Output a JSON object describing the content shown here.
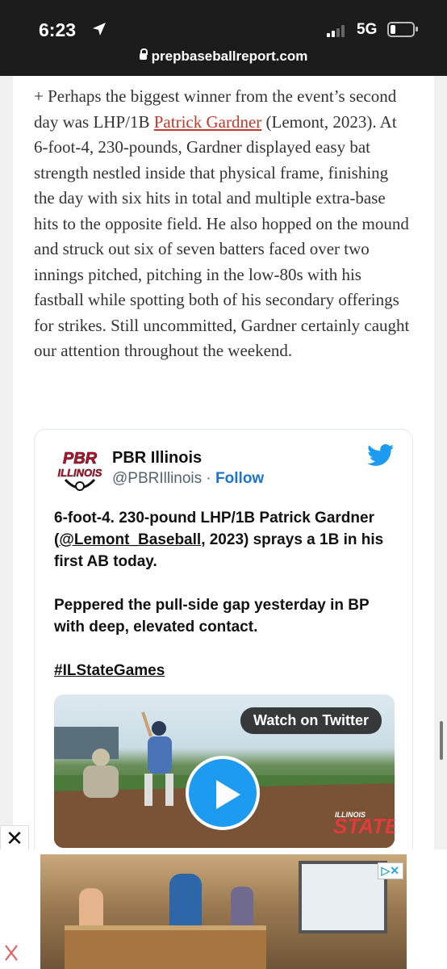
{
  "status_bar": {
    "time": "6:23",
    "network": "5G"
  },
  "browser": {
    "url": "prepbaseballreport.com"
  },
  "article": {
    "text_before_link": "+ Perhaps the biggest winner from the event’s second day was LHP/1B ",
    "link_text": "Patrick Gardner",
    "text_after_link": " (Lemont, 2023). At 6-foot-4, 230-pounds, Gardner displayed easy bat strength nestled inside that physical frame, finishing the day with six hits in total and multiple extra-base hits to the opposite field. He also hopped on the mound and struck out six of seven batters faced over two innings pitched, pitching in the low-80s with his fastball while spotting both of his secondary offerings for strikes. Still uncommitted, Gardner certainly caught our attention throughout the weekend."
  },
  "tweet": {
    "avatar_text_top": "PBR",
    "avatar_text_bottom": "ILLINOIS",
    "name": "PBR Illinois",
    "handle": "@PBRIllinois",
    "separator": " · ",
    "follow_label": "Follow",
    "line1_before": "6-foot-4. 230-pound LHP/1B Patrick Gardner (",
    "mention": "@Lemont_Baseball",
    "line1_after": ", 2023) sprays a 1B in his first AB today.",
    "paragraph2": "Peppered the pull-side gap yesterday in BP with deep, elevated contact.",
    "hashtag": "#ILStateGames",
    "watch_label": "Watch on Twitter",
    "video_overlay_top": "ILLINOIS",
    "video_overlay_main": "STATE"
  },
  "ad": {
    "close_label": "✕",
    "choices_label": "▷✕"
  },
  "colors": {
    "link": "#c0392b",
    "twitter_blue": "#1d9bf0",
    "follow": "#1d73c9"
  }
}
